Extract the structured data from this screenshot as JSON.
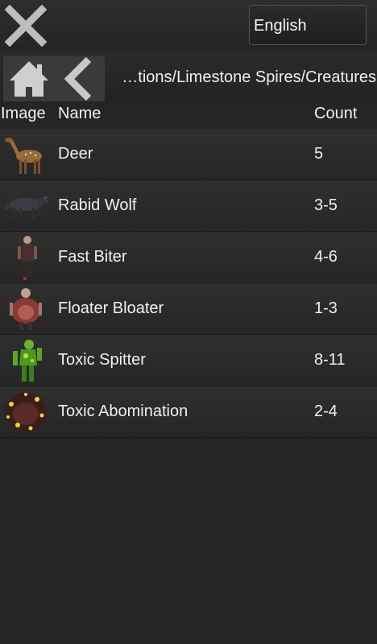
{
  "header": {
    "language": "English"
  },
  "nav": {
    "breadcrumb": "…tions/Limestone Spires/Creatures"
  },
  "table": {
    "columns": [
      "Image",
      "Name",
      "Count"
    ],
    "rows": [
      {
        "name": "Deer",
        "count": "5",
        "icon": "deer-thumbnail"
      },
      {
        "name": "Rabid Wolf",
        "count": "3-5",
        "icon": "rabid-wolf-thumbnail"
      },
      {
        "name": "Fast Biter",
        "count": "4-6",
        "icon": "fast-biter-thumbnail"
      },
      {
        "name": "Floater Bloater",
        "count": "1-3",
        "icon": "floater-bloater-thumbnail"
      },
      {
        "name": "Toxic Spitter",
        "count": "8-11",
        "icon": "toxic-spitter-thumbnail"
      },
      {
        "name": "Toxic Abomination",
        "count": "2-4",
        "icon": "toxic-abomination-thumbnail"
      }
    ]
  }
}
